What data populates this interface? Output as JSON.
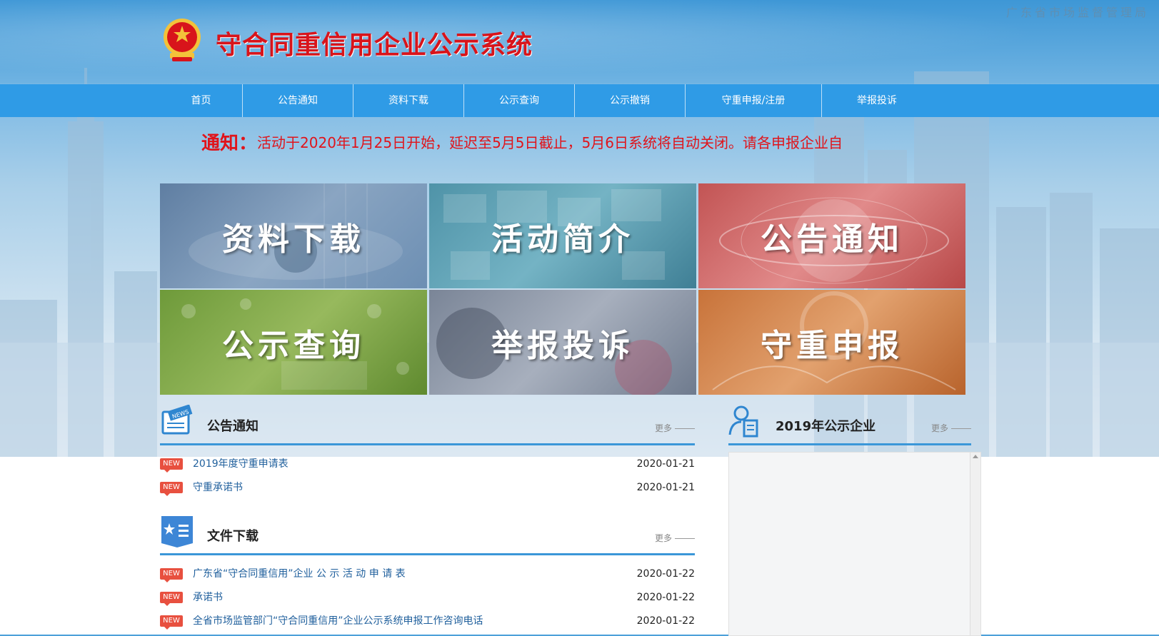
{
  "header": {
    "agency": "广东省市场监督管理局",
    "title": "守合同重信用企业公示系统"
  },
  "nav": {
    "items": [
      {
        "label": "首页"
      },
      {
        "label": "公告通知"
      },
      {
        "label": "资料下载"
      },
      {
        "label": "公示查询"
      },
      {
        "label": "公示撤销"
      },
      {
        "label": "守重申报/注册"
      },
      {
        "label": "举报投诉"
      }
    ]
  },
  "notice": {
    "label": "通知：",
    "text": "活动于2020年1月25日开始，延迟至5月5日截止，5月6日系统将自动关闭。请各申报企业自"
  },
  "tiles": [
    {
      "label": "资料下载"
    },
    {
      "label": "活动简介"
    },
    {
      "label": "公告通知"
    },
    {
      "label": "公示查询"
    },
    {
      "label": "举报投诉"
    },
    {
      "label": "守重申报"
    }
  ],
  "announcements": {
    "title": "公告通知",
    "more": "更多",
    "icon_text": "NEWS",
    "items": [
      {
        "badge": "NEW",
        "title": "2019年度守重申请表",
        "date": "2020-01-21"
      },
      {
        "badge": "NEW",
        "title": "守重承诺书",
        "date": "2020-01-21"
      }
    ]
  },
  "downloads": {
    "title": "文件下载",
    "more": "更多",
    "items": [
      {
        "badge": "NEW",
        "title": "广东省“守合同重信用”企业 公 示 活 动 申 请 表",
        "date": "2020-01-22"
      },
      {
        "badge": "NEW",
        "title": "承诺书",
        "date": "2020-01-22"
      },
      {
        "badge": "NEW",
        "title": "全省市场监管部门“守合同重信用”企业公示系统申报工作咨询电话",
        "date": "2020-01-22"
      }
    ]
  },
  "companies": {
    "title": "2019年公示企业",
    "more": "更多"
  },
  "colors": {
    "nav_bg": "#2f9be6",
    "title_red": "#d8141b",
    "link_blue": "#1f5f9c",
    "badge_red": "#e8503f"
  }
}
